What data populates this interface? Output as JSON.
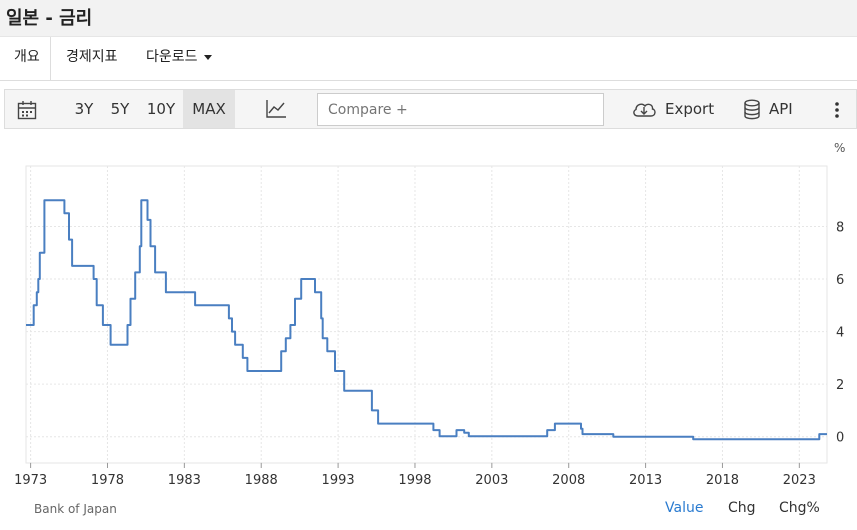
{
  "header": {
    "title": "일본 - 금리"
  },
  "nav": {
    "overview": "개요",
    "indicators": "경제지표",
    "download": "다운로드"
  },
  "toolbar": {
    "ranges": [
      "3Y",
      "5Y",
      "10Y",
      "MAX"
    ],
    "active_range": "MAX",
    "compare_placeholder": "Compare +",
    "export_label": "Export",
    "api_label": "API"
  },
  "footer": {
    "source": "Bank of Japan",
    "views": [
      "Value",
      "Chg",
      "Chg%"
    ],
    "active_view": "Value"
  },
  "colors": {
    "line": "#4a7fc1",
    "active_tab": "#2a7bd0",
    "toolbar_bg": "#f5f5f5"
  },
  "chart_data": {
    "type": "line",
    "title": "",
    "xlabel": "",
    "ylabel": "%",
    "xlim": [
      1972.7,
      2024.8
    ],
    "ylim": [
      -1,
      10.3
    ],
    "x_ticks": [
      "1973",
      "1978",
      "1983",
      "1988",
      "1993",
      "1998",
      "2003",
      "2008",
      "2013",
      "2018",
      "2023"
    ],
    "y_ticks": [
      0,
      2,
      4,
      6,
      8
    ],
    "grid": true,
    "series": [
      {
        "name": "",
        "step": true,
        "points": [
          [
            1972.7,
            4.25
          ],
          [
            1973.2,
            5.0
          ],
          [
            1973.4,
            5.5
          ],
          [
            1973.5,
            6.0
          ],
          [
            1973.6,
            7.0
          ],
          [
            1973.9,
            9.0
          ],
          [
            1975.2,
            8.5
          ],
          [
            1975.5,
            7.5
          ],
          [
            1975.7,
            6.5
          ],
          [
            1977.1,
            6.0
          ],
          [
            1977.3,
            5.0
          ],
          [
            1977.7,
            4.25
          ],
          [
            1978.2,
            3.5
          ],
          [
            1979.3,
            4.25
          ],
          [
            1979.5,
            5.25
          ],
          [
            1979.8,
            6.25
          ],
          [
            1980.1,
            7.25
          ],
          [
            1980.2,
            9.0
          ],
          [
            1980.6,
            8.25
          ],
          [
            1980.8,
            7.25
          ],
          [
            1981.1,
            6.25
          ],
          [
            1981.8,
            5.5
          ],
          [
            1983.7,
            5.0
          ],
          [
            1985.9,
            4.5
          ],
          [
            1986.1,
            4.0
          ],
          [
            1986.3,
            3.5
          ],
          [
            1986.8,
            3.0
          ],
          [
            1987.1,
            2.5
          ],
          [
            1989.3,
            3.25
          ],
          [
            1989.6,
            3.75
          ],
          [
            1989.9,
            4.25
          ],
          [
            1990.2,
            5.25
          ],
          [
            1990.6,
            6.0
          ],
          [
            1991.5,
            5.5
          ],
          [
            1991.9,
            4.5
          ],
          [
            1992.0,
            3.75
          ],
          [
            1992.3,
            3.25
          ],
          [
            1992.8,
            2.5
          ],
          [
            1993.4,
            1.75
          ],
          [
            1995.2,
            1.0
          ],
          [
            1995.6,
            0.5
          ],
          [
            1999.2,
            0.25
          ],
          [
            1999.6,
            0.02
          ],
          [
            2000.7,
            0.25
          ],
          [
            2001.2,
            0.15
          ],
          [
            2001.5,
            0.02
          ],
          [
            2006.6,
            0.25
          ],
          [
            2007.1,
            0.5
          ],
          [
            2008.8,
            0.3
          ],
          [
            2008.9,
            0.1
          ],
          [
            2010.9,
            0.0
          ],
          [
            2016.1,
            -0.1
          ],
          [
            2024.3,
            0.1
          ],
          [
            2024.8,
            0.1
          ]
        ]
      }
    ]
  }
}
